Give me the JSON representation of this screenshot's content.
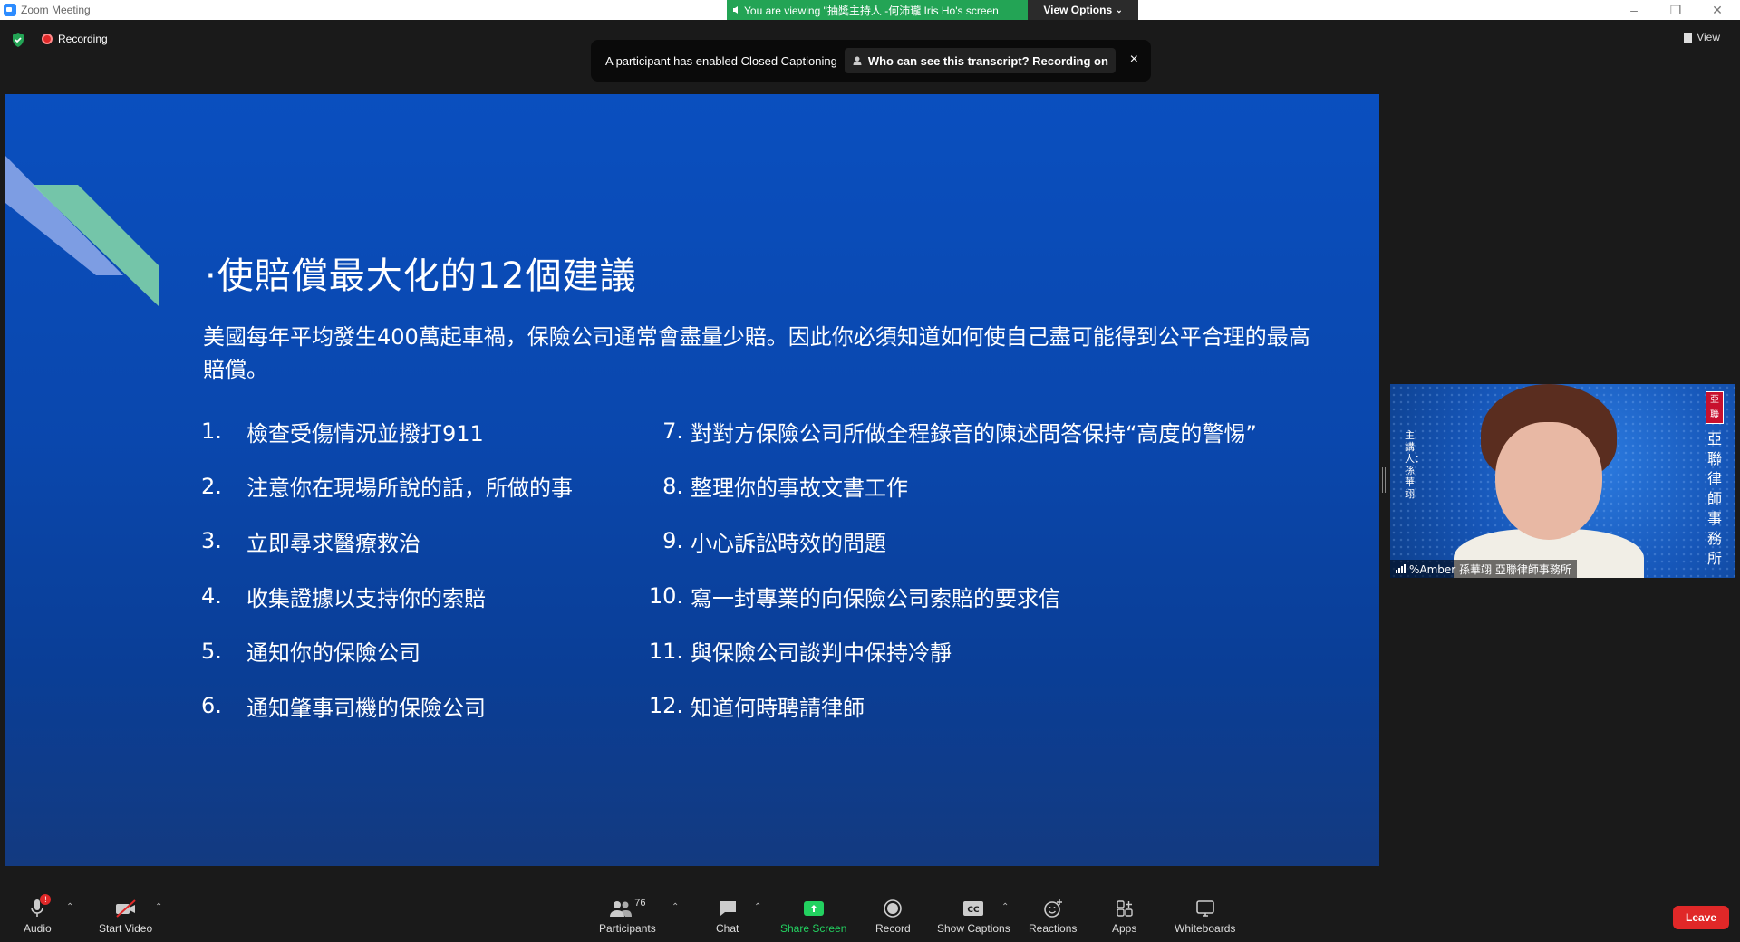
{
  "window": {
    "app_title": "Zoom Meeting",
    "viewing_banner": "You are viewing \"抽獎主持人 -何沛瓏 Iris Ho's screen",
    "view_options_label": "View Options",
    "controls": [
      "–",
      "❐",
      "✕"
    ]
  },
  "topbar": {
    "recording_label": "Recording",
    "view_label": "View"
  },
  "captions_banner": {
    "message": "A participant has enabled Closed Captioning",
    "who_label": "Who can see this transcript? Recording on",
    "close_glyph": "×"
  },
  "slide": {
    "title": "·使賠償最大化的12個建議",
    "intro": "美國每年平均發生400萬起車禍，保險公司通常會盡量少賠。因此你必須知道如何使自己盡可能得到公平合理的最高賠償。",
    "left_items": [
      {
        "num": "1.",
        "text": "檢查受傷情況並撥打911"
      },
      {
        "num": "2.",
        "text": "注意你在現場所說的話，所做的事"
      },
      {
        "num": "3.",
        "text": "立即尋求醫療救治"
      },
      {
        "num": "4.",
        "text": "收集證據以支持你的索賠"
      },
      {
        "num": "5.",
        "text": "通知你的保險公司"
      },
      {
        "num": "6.",
        "text": "通知肇事司機的保險公司"
      }
    ],
    "right_items": [
      {
        "num": "7.",
        "text": "對對方保險公司所做全程錄音的陳述問答保持“高度的警惕”"
      },
      {
        "num": "8.",
        "text": "整理你的事故文書工作"
      },
      {
        "num": "9.",
        "text": "小心訴訟時效的問題"
      },
      {
        "num": "10.",
        "text": "寫一封專業的向保險公司索賠的要求信"
      },
      {
        "num": "11.",
        "text": "與保險公司談判中保持冷靜"
      },
      {
        "num": "12.",
        "text": "知道何時聘請律師"
      }
    ]
  },
  "video": {
    "participant_name": "%Amber 孫華翊 亞聯律師事務所",
    "left_caption": "主講人：孫華翊",
    "seal_text": "亞聯",
    "firm_name": "亞聯律師事務所"
  },
  "toolbar": {
    "audio": "Audio",
    "start_video": "Start Video",
    "participants": "Participants",
    "participants_count": "76",
    "chat": "Chat",
    "share_screen": "Share Screen",
    "record": "Record",
    "show_captions": "Show Captions",
    "reactions": "Reactions",
    "apps": "Apps",
    "whiteboards": "Whiteboards",
    "leave": "Leave",
    "audio_badge": "!"
  },
  "colors": {
    "share_green": "#23d160",
    "leave_red": "#e02828",
    "slide_blue": "#0a4fbf",
    "viewing_green": "#23a455"
  }
}
